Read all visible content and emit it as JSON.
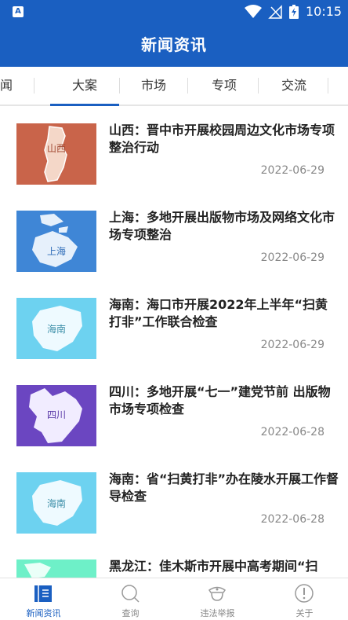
{
  "status_bar": {
    "time": "10:15"
  },
  "header": {
    "title": "新闻资讯"
  },
  "tabs": [
    {
      "label": "要闻"
    },
    {
      "label": "大案"
    },
    {
      "label": "市场"
    },
    {
      "label": "专项"
    },
    {
      "label": "交流"
    }
  ],
  "active_tab": "大案",
  "news": [
    {
      "title": "山西：晋中市开展校园周边文化市场专项整治行动",
      "date": "2022-06-29",
      "region": "山西",
      "thumb_color": "#c9644a"
    },
    {
      "title": "上海：多地开展出版物市场及网络文化市场专项整治",
      "date": "2022-06-29",
      "region": "上海",
      "thumb_color": "#3f86d6"
    },
    {
      "title": "海南：海口市开展2022年上半年“扫黄打非”工作联合检查",
      "date": "2022-06-29",
      "region": "海南",
      "thumb_color": "#6dd2f0"
    },
    {
      "title": "四川：多地开展“七一”建党节前 出版物市场专项检查",
      "date": "2022-06-28",
      "region": "四川",
      "thumb_color": "#6b46c1"
    },
    {
      "title": "海南：省“扫黄打非”办在陵水开展工作督导检查",
      "date": "2022-06-28",
      "region": "海南",
      "thumb_color": "#6dd2f0"
    },
    {
      "title": "黑龙江：佳木斯市开展中高考期间“扫",
      "date": "",
      "region": "",
      "thumb_color": "#6ef0c8"
    }
  ],
  "bottom_nav": [
    {
      "label": "新闻资讯",
      "icon": "news-icon"
    },
    {
      "label": "查询",
      "icon": "search-icon"
    },
    {
      "label": "违法举报",
      "icon": "police-icon"
    },
    {
      "label": "关于",
      "icon": "info-icon"
    }
  ],
  "colors": {
    "primary": "#1a5fc1",
    "nav_inactive": "#888888"
  }
}
